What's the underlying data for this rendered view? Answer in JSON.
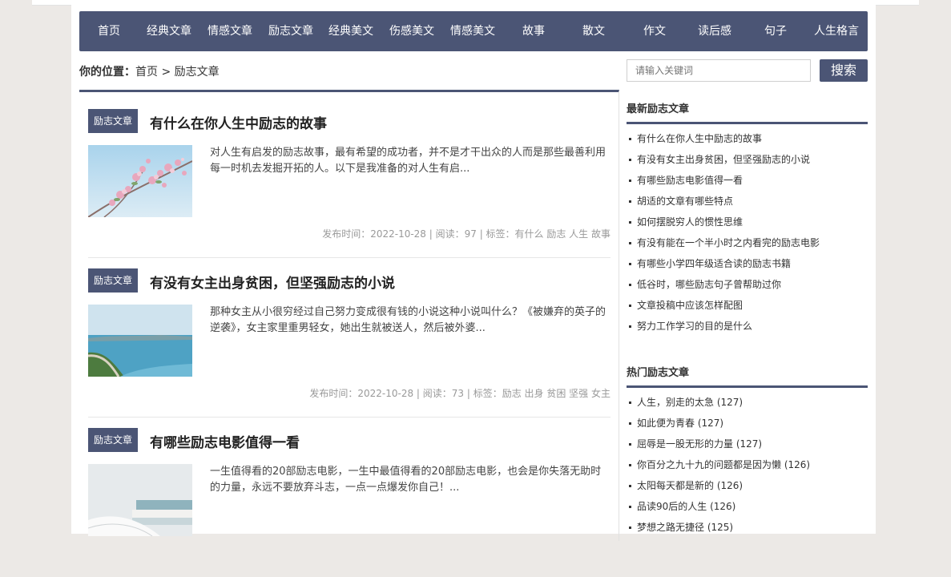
{
  "nav": {
    "items": [
      "首页",
      "经典文章",
      "情感文章",
      "励志文章",
      "经典美文",
      "伤感美文",
      "情感美文",
      "故事",
      "散文",
      "作文",
      "读后感",
      "句子",
      "人生格言"
    ]
  },
  "breadcrumb": {
    "label": "你的位置：",
    "home": "首页",
    "separator": " > ",
    "current": "励志文章"
  },
  "search": {
    "placeholder": "请输入关键词",
    "button": "搜索"
  },
  "articles": [
    {
      "category": "励志文章",
      "title": "有什么在你人生中励志的故事",
      "summary": "对人生有启发的励志故事，最有希望的成功者，并不是才干出众的人而是那些最善利用每一时机去发掘开拓的人。以下是我准备的对人生有启...",
      "meta": "发布时间：2022-10-28 | 阅读：97 | 标签：有什么 励志 人生 故事"
    },
    {
      "category": "励志文章",
      "title": "有没有女主出身贫困，但坚强励志的小说",
      "summary": "那种女主从小很穷经过自己努力变成很有钱的小说这种小说叫什么？《被嫌弃的英子的逆袭》，女主家里重男轻女，她出生就被送人，然后被外婆...",
      "meta": "发布时间：2022-10-28 | 阅读：73 | 标签：励志 出身 贫困 坚强 女主"
    },
    {
      "category": "励志文章",
      "title": "有哪些励志电影值得一看",
      "summary": "一生值得看的20部励志电影，一生中最值得看的20部励志电影，也会是你失落无助时的力量，永远不要放弃斗志，一点一点爆发你自己！...",
      "meta": ""
    }
  ],
  "sidebar": {
    "latest_title": "最新励志文章",
    "latest": [
      "有什么在你人生中励志的故事",
      "有没有女主出身贫困，但坚强励志的小说",
      "有哪些励志电影值得一看",
      "胡适的文章有哪些特点",
      "如何摆脱穷人的惯性思维",
      "有没有能在一个半小时之内看完的励志电影",
      "有哪些小学四年级适合读的励志书籍",
      "低谷时，哪些励志句子曾帮助过你",
      "文章投稿中应该怎样配图",
      "努力工作学习的目的是什么"
    ],
    "hot_title": "热门励志文章",
    "hot": [
      "人生，别走的太急 (127)",
      "如此便为青春 (127)",
      "屈辱是一股无形的力量 (127)",
      "你百分之九十九的问题都是因为懒 (126)",
      "太阳每天都是新的 (126)",
      "品读90后的人生 (126)",
      "梦想之路无捷径 (125)"
    ]
  },
  "colors": {
    "accent": "#4b5575",
    "background": "#ece9e6"
  }
}
